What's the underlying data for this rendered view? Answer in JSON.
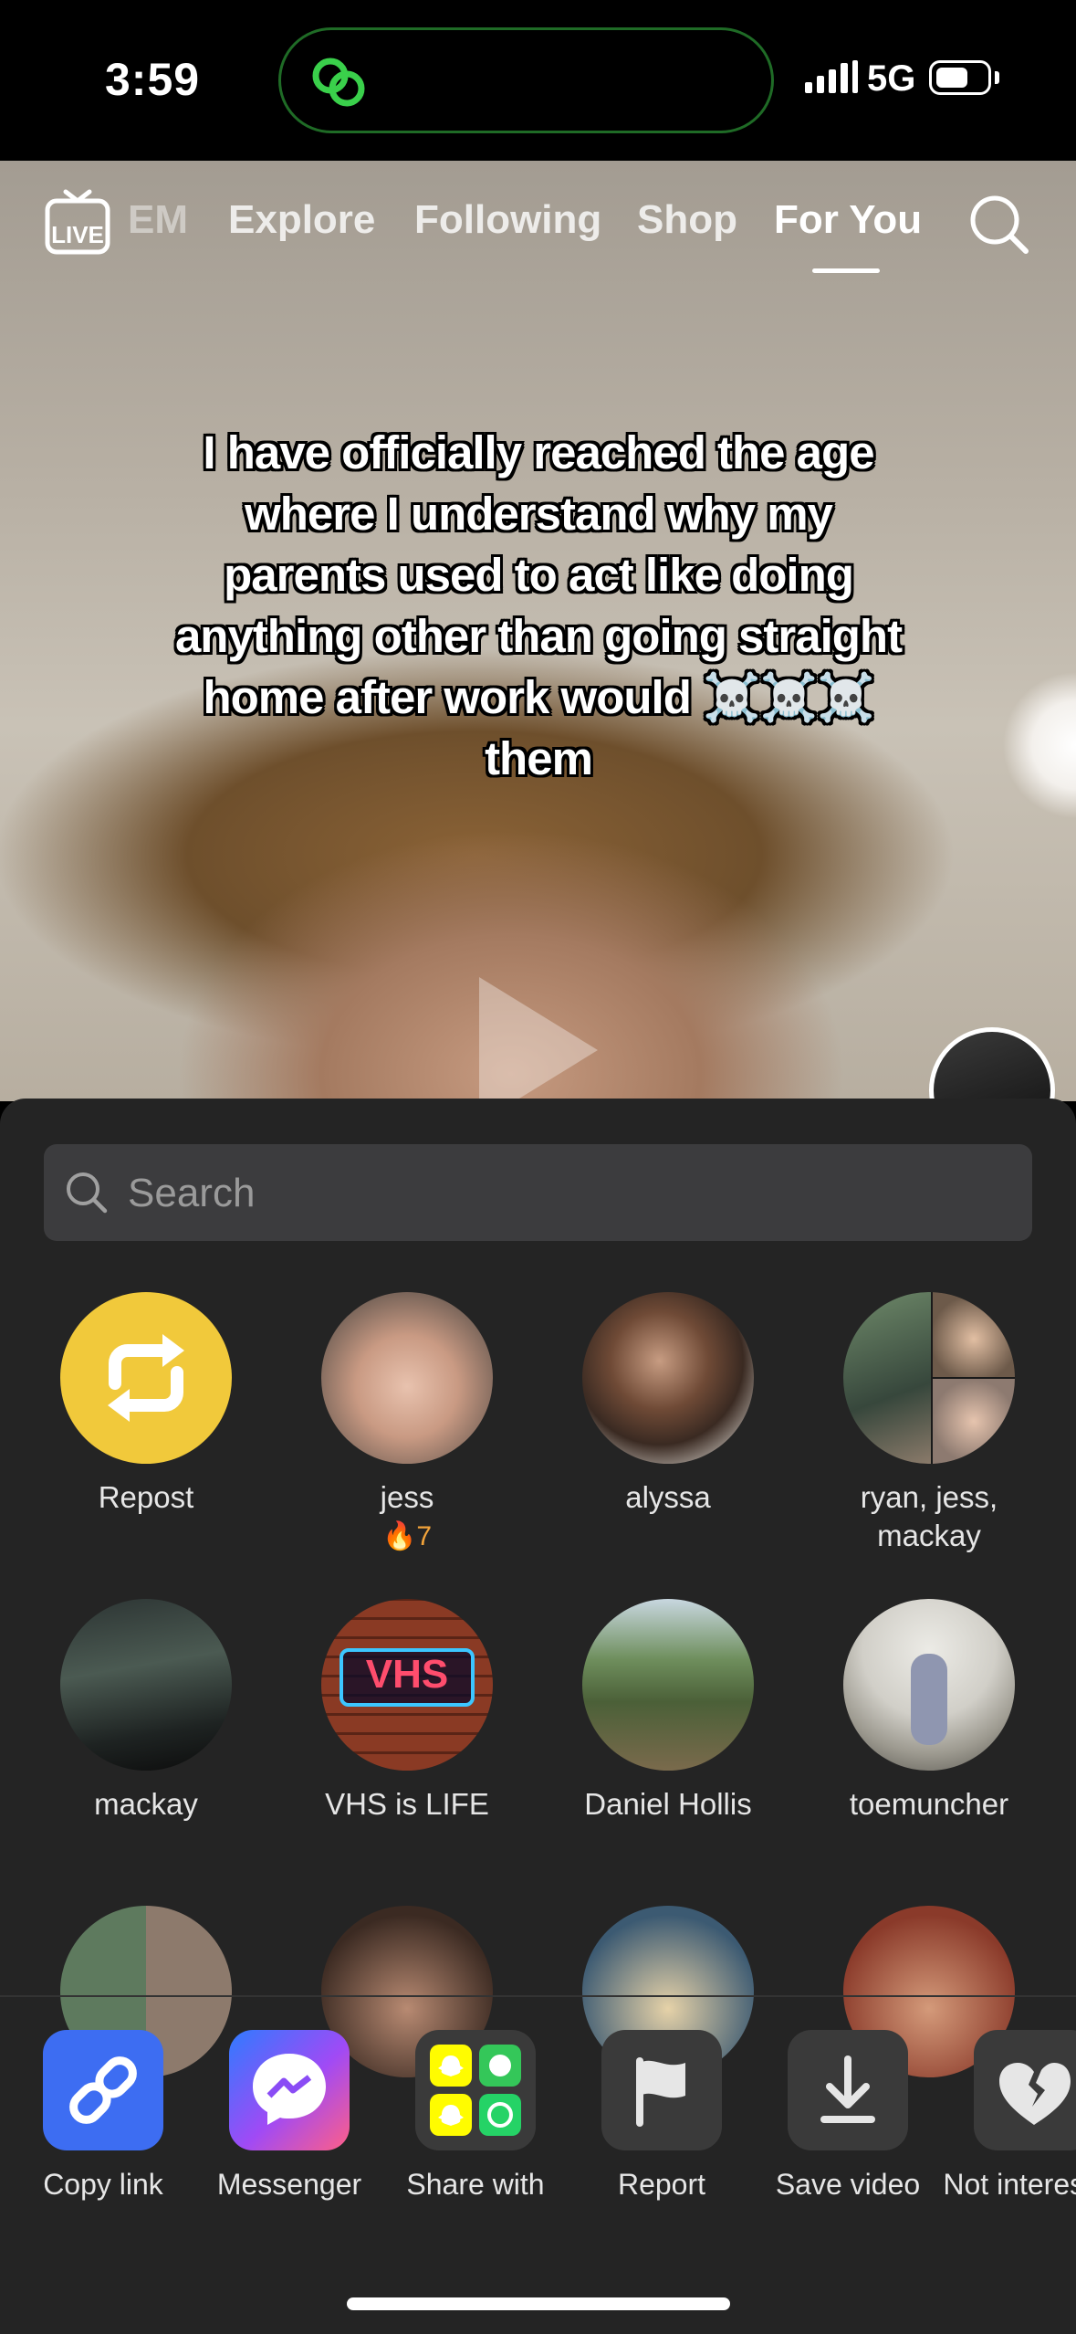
{
  "status_bar": {
    "time": "3:59",
    "network": "5G"
  },
  "nav": {
    "live_label": "LIVE",
    "items": [
      {
        "label": "EM",
        "active": false
      },
      {
        "label": "Explore",
        "active": false
      },
      {
        "label": "Following",
        "active": false
      },
      {
        "label": "Shop",
        "active": false
      },
      {
        "label": "For You",
        "active": true
      }
    ]
  },
  "video": {
    "caption": "I have officially reached the age where I understand why my parents used to act like doing anything other than going straight home after work would ☠️☠️☠️ them"
  },
  "share_sheet": {
    "search": {
      "placeholder": "Search",
      "value": ""
    },
    "contacts_row1": [
      {
        "name": "Repost",
        "streak": ""
      },
      {
        "name": "jess",
        "streak": "🔥7"
      },
      {
        "name": "alyssa",
        "streak": ""
      },
      {
        "name": "ryan, jess, mackay",
        "streak": ""
      }
    ],
    "contacts_row2": [
      {
        "name": "mackay"
      },
      {
        "name": "VHS is LIFE"
      },
      {
        "name": "Daniel Hollis"
      },
      {
        "name": "toemuncher"
      }
    ],
    "actions": [
      {
        "label": "Copy link",
        "icon": "link-icon",
        "color": "#3d6df2"
      },
      {
        "label": "Messenger",
        "icon": "messenger-icon",
        "color": "#a04af5"
      },
      {
        "label": "Share with",
        "icon": "apps-icon",
        "color": "#3a3a3a"
      },
      {
        "label": "Report",
        "icon": "flag-icon",
        "color": "#3a3a3a"
      },
      {
        "label": "Save video",
        "icon": "download-icon",
        "color": "#3a3a3a"
      },
      {
        "label": "Not interested",
        "icon": "broken-heart-icon",
        "color": "#3a3a3a"
      }
    ],
    "repost_color": "#f1c93b"
  }
}
